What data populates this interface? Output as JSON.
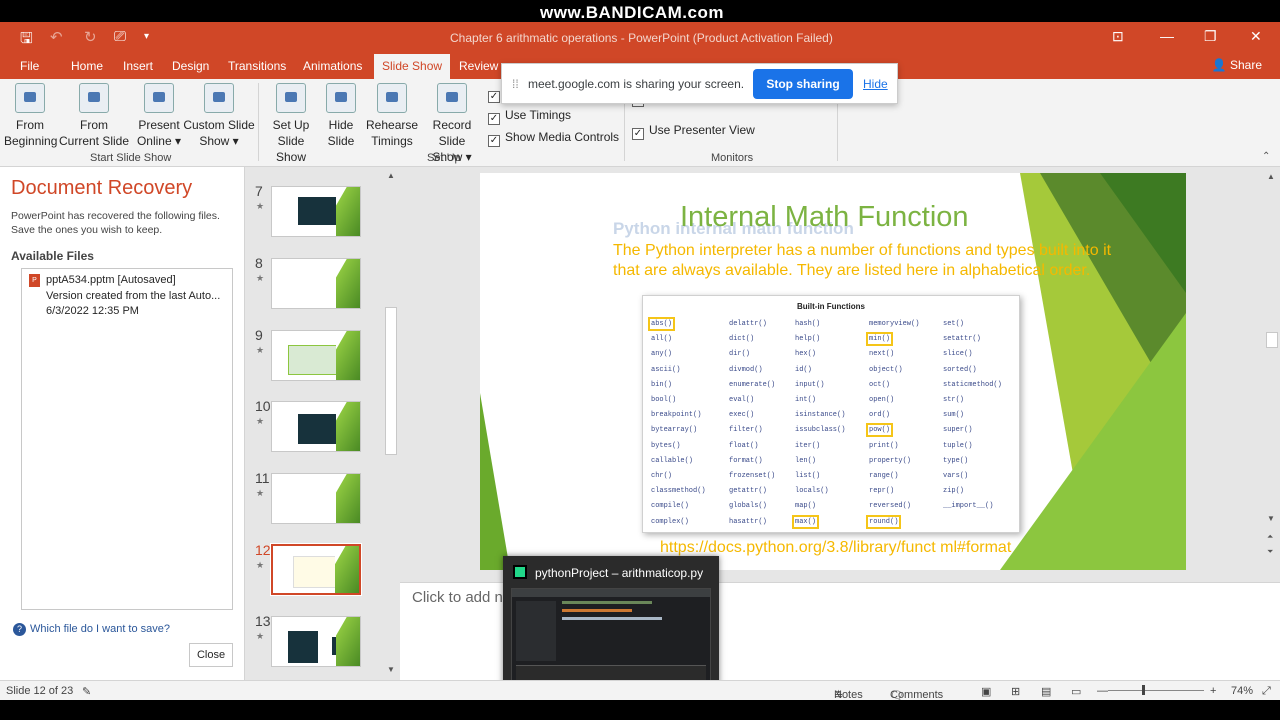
{
  "app": {
    "title": "Chapter 6 arithmatic operations - PowerPoint (Product Activation Failed)",
    "watermark": "www.BANDICAM.com"
  },
  "tabs": [
    "File",
    "Home",
    "Insert",
    "Design",
    "Transitions",
    "Animations",
    "Slide Show",
    "Review"
  ],
  "active_tab": "Slide Show",
  "share_label": "Share",
  "ribbon": {
    "start_group": "Start Slide Show",
    "from_beginning": [
      "From",
      "Beginning"
    ],
    "from_current": [
      "From",
      "Current Slide"
    ],
    "present_online": [
      "Present",
      "Online ▾"
    ],
    "custom_show": [
      "Custom Slide",
      "Show ▾"
    ],
    "setup_group": "Set Up",
    "set_up": [
      "Set Up",
      "Slide Show"
    ],
    "hide_slide": [
      "Hide",
      "Slide"
    ],
    "rehearse": [
      "Rehearse",
      "Timings"
    ],
    "record": [
      "Record Slide",
      "Show ▾"
    ],
    "use_timings": "Use Timings",
    "show_media": "Show Media Controls",
    "monitors_group": "Monitors",
    "presenter_view": "Use Presenter View"
  },
  "meet": {
    "text": "meet.google.com is sharing your screen.",
    "stop": "Stop sharing",
    "hide": "Hide"
  },
  "recovery": {
    "title": "Document Recovery",
    "desc": "PowerPoint has recovered the following files. Save the ones you wish to keep.",
    "available": "Available Files",
    "file_name": "pptA534.pptm  [Autosaved]",
    "file_desc": "Version created from the last Auto...",
    "file_date": "6/3/2022 12:35 PM",
    "help": "Which file do I want to save?",
    "close": "Close"
  },
  "thumbs": [
    "7",
    "8",
    "9",
    "10",
    "11",
    "12",
    "13"
  ],
  "selected_slide": "12",
  "slide": {
    "title": "Internal Math Function",
    "ghost": "Python internal math function",
    "body": "The Python interpreter has a number of functions and types built into it that are always available. They are listed here in alphabetical order.",
    "table_title": "Built-in Functions",
    "link": "https://docs.python.org/3.8/library/funct   ml#format",
    "functions": [
      [
        "abs()",
        "delattr()",
        "hash()",
        "memoryview()",
        "set()"
      ],
      [
        "all()",
        "dict()",
        "help()",
        "min()",
        "setattr()"
      ],
      [
        "any()",
        "dir()",
        "hex()",
        "next()",
        "slice()"
      ],
      [
        "ascii()",
        "divmod()",
        "id()",
        "object()",
        "sorted()"
      ],
      [
        "bin()",
        "enumerate()",
        "input()",
        "oct()",
        "staticmethod()"
      ],
      [
        "bool()",
        "eval()",
        "int()",
        "open()",
        "str()"
      ],
      [
        "breakpoint()",
        "exec()",
        "isinstance()",
        "ord()",
        "sum()"
      ],
      [
        "bytearray()",
        "filter()",
        "issubclass()",
        "pow()",
        "super()"
      ],
      [
        "bytes()",
        "float()",
        "iter()",
        "print()",
        "tuple()"
      ],
      [
        "callable()",
        "format()",
        "len()",
        "property()",
        "type()"
      ],
      [
        "chr()",
        "frozenset()",
        "list()",
        "range()",
        "vars()"
      ],
      [
        "classmethod()",
        "getattr()",
        "locals()",
        "repr()",
        "zip()"
      ],
      [
        "compile()",
        "globals()",
        "map()",
        "reversed()",
        "__import__()"
      ],
      [
        "complex()",
        "hasattr()",
        "max()",
        "round()",
        ""
      ]
    ],
    "highlighted": [
      "abs()",
      "min()",
      "pow()",
      "max()",
      "round()"
    ]
  },
  "notes_placeholder": "Click to add no",
  "taskbar_popup": "pythonProject – arithmaticop.py",
  "status": {
    "slide": "Slide 12 of 23",
    "notes": "Notes",
    "comments": "Comments",
    "zoom": "74%"
  }
}
